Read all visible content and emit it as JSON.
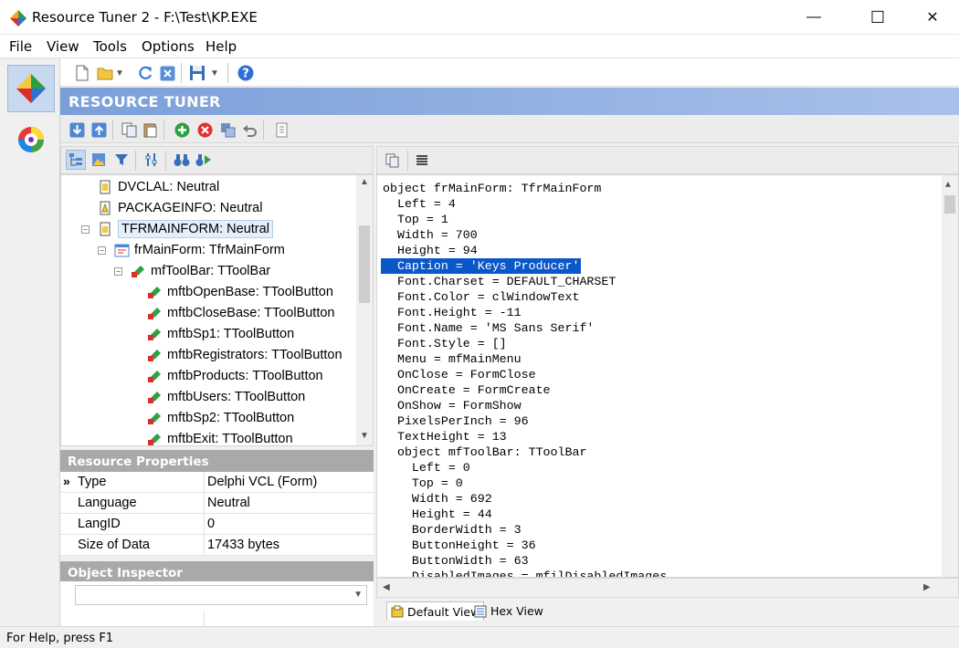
{
  "window": {
    "title": "Resource Tuner 2 - F:\\Test\\KP.EXE",
    "minimize": "—",
    "maximize": "☐",
    "close": "✕"
  },
  "menu": [
    "File",
    "View",
    "Tools",
    "Options",
    "Help"
  ],
  "banner": {
    "title": "RESOURCE TUNER"
  },
  "tree": {
    "nodes": [
      {
        "label": "DVCLAL: Neutral"
      },
      {
        "label": "PACKAGEINFO: Neutral"
      },
      {
        "label": "TFRMAINFORM: Neutral"
      },
      {
        "label": "frMainForm: TfrMainForm"
      },
      {
        "label": "mfToolBar: TToolBar"
      },
      {
        "label": "mftbOpenBase: TToolButton"
      },
      {
        "label": "mftbCloseBase: TToolButton"
      },
      {
        "label": "mftbSp1: TToolButton"
      },
      {
        "label": "mftbRegistrators: TToolButton"
      },
      {
        "label": "mftbProducts: TToolButton"
      },
      {
        "label": "mftbUsers: TToolButton"
      },
      {
        "label": "mftbSp2: TToolButton"
      },
      {
        "label": "mftbExit: TToolButton"
      }
    ]
  },
  "resource_properties": {
    "header": "Resource Properties",
    "rows": [
      {
        "key": "Type",
        "value": "Delphi VCL (Form)"
      },
      {
        "key": "Language",
        "value": "Neutral"
      },
      {
        "key": "LangID",
        "value": "0"
      },
      {
        "key": "Size of Data",
        "value": "17433 bytes"
      }
    ]
  },
  "object_inspector": {
    "header": "Object Inspector"
  },
  "code": {
    "lines": [
      "object frMainForm: TfrMainForm",
      "  Left = 4",
      "  Top = 1",
      "  Width = 700",
      "  Height = 94",
      "  Caption = 'Keys Producer'",
      "  Font.Charset = DEFAULT_CHARSET",
      "  Font.Color = clWindowText",
      "  Font.Height = -11",
      "  Font.Name = 'MS Sans Serif'",
      "  Font.Style = []",
      "  Menu = mfMainMenu",
      "  OnClose = FormClose",
      "  OnCreate = FormCreate",
      "  OnShow = FormShow",
      "  PixelsPerInch = 96",
      "  TextHeight = 13",
      "  object mfToolBar: TToolBar",
      "    Left = 0",
      "    Top = 0",
      "    Width = 692",
      "    Height = 44",
      "    BorderWidth = 3",
      "    ButtonHeight = 36",
      "    ButtonWidth = 63",
      "    DisabledImages = mfilDisabledImages"
    ]
  },
  "tabs": {
    "default_view": "Default View",
    "hex_view": "Hex View"
  },
  "status": {
    "text": "For Help, press F1"
  }
}
